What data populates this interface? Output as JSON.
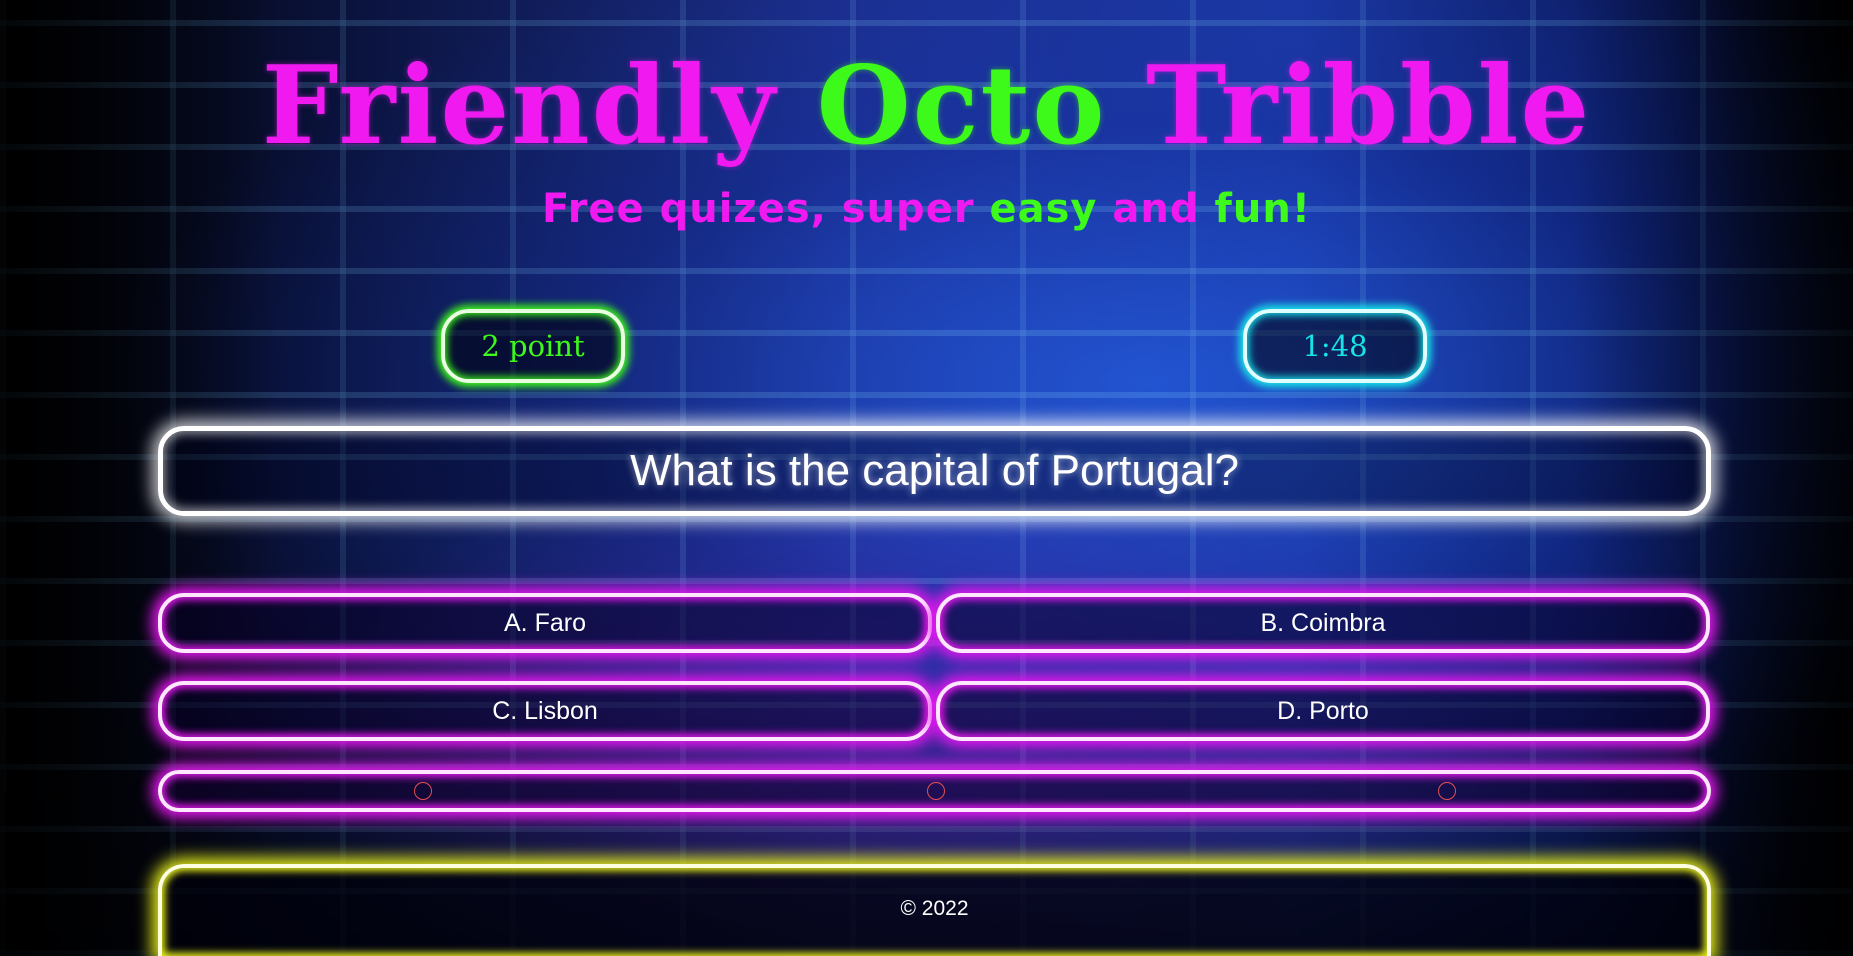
{
  "header": {
    "title_word1": "Friendly",
    "title_word2": "Octo",
    "title_word3": "Tribble",
    "subtitle_part1": "Free quizes, super ",
    "subtitle_part2": "easy",
    "subtitle_part3": " and ",
    "subtitle_part4": "fun!"
  },
  "status": {
    "score": "2 point",
    "timer": "1:48"
  },
  "quiz": {
    "question": "What is the capital of Portugal?",
    "answers": [
      "A. Faro",
      "B. Coimbra",
      "C. Lisbon",
      "D. Porto"
    ]
  },
  "lifelines": {
    "icons": [
      "circle-icon",
      "circle-icon",
      "circle-icon"
    ]
  },
  "footer": {
    "copyright": "© 2022"
  },
  "colors": {
    "pink": "#f01af0",
    "green": "#3dfa1a",
    "cyan": "#17e4e8",
    "magenta_glow": "#e617f0",
    "yellow_glow": "#e8f01a",
    "white": "#ffffff"
  }
}
